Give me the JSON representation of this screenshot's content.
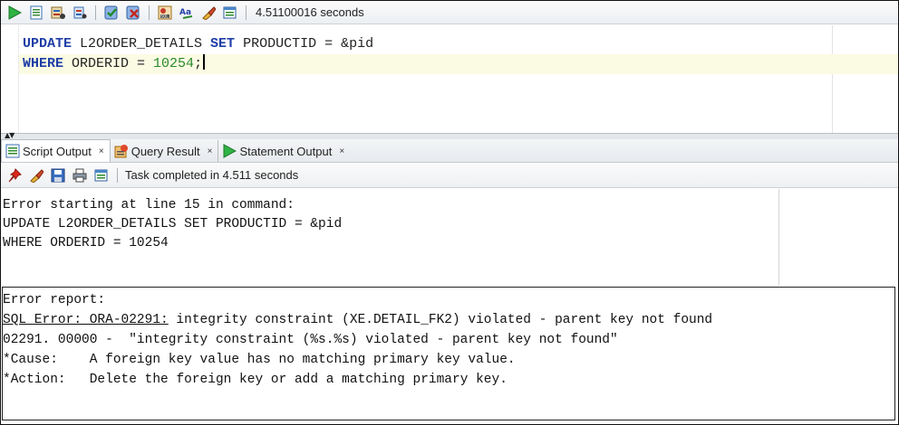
{
  "toolbar": {
    "buttons": [
      "run-statement-icon",
      "run-script-icon",
      "autotrace-icon",
      "explain-plan-icon",
      "commit-icon",
      "rollback-icon",
      "sql-tuning-icon",
      "format-icon",
      "clear-icon",
      "history-icon"
    ],
    "timing": "4.51100016 seconds"
  },
  "editor": {
    "line1": {
      "kw1": "UPDATE",
      "t1": " L2ORDER_DETAILS ",
      "kw2": "SET",
      "t2": " PRODUCTID = &pid"
    },
    "line2": {
      "kw1": "WHERE",
      "t1": " ORDERID = ",
      "num": "10254",
      "t2": ";"
    }
  },
  "tabs": [
    {
      "label": "Script Output",
      "close": "×",
      "active": true
    },
    {
      "label": "Query Result",
      "close": "×",
      "active": false
    },
    {
      "label": "Statement Output",
      "close": "×",
      "active": false
    }
  ],
  "output_toolbar": {
    "status": "Task completed in 4.511 seconds"
  },
  "output": {
    "lines": [
      "Error starting at line 15 in command:",
      "UPDATE L2ORDER_DETAILS SET PRODUCTID = &pid",
      "WHERE ORDERID = 10254"
    ],
    "report_title": "Error report:",
    "sql_error_link": "SQL Error: ORA-02291:",
    "sql_error_rest": " integrity constraint (XE.DETAIL_FK2) violated - parent key not found",
    "code_line": "02291. 00000 -  \"integrity constraint (%s.%s) violated - parent key not found\"",
    "cause_label": "*Cause:",
    "cause_text": "    A foreign key value has no matching primary key value.",
    "action_label": "*Action:",
    "action_text": "   Delete the foreign key or add a matching primary key."
  },
  "colors": {
    "keyword": "#1f3ea6",
    "number": "#2a8a2a",
    "current_line": "#fbfbe3"
  }
}
